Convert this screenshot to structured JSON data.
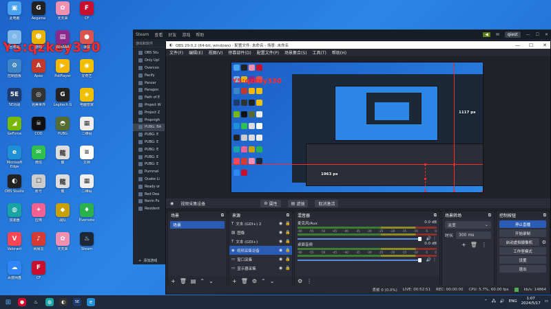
{
  "watermark": "YS:qzkey330",
  "desktop_icons": [
    {
      "label": "此电脑",
      "color": "#4aa3f0",
      "glyph": "▣"
    },
    {
      "label": "Aegame",
      "color": "#222222",
      "glyph": "G"
    },
    {
      "label": "天天来",
      "color": "#f08fb0",
      "glyph": "✿"
    },
    {
      "label": "CF",
      "color": "#c8102e",
      "glyph": "F"
    },
    {
      "label": "回收站",
      "color": "#7fb8e8",
      "glyph": "♲"
    },
    {
      "label": "游戏",
      "color": "#e8b400",
      "glyph": "☻"
    },
    {
      "label": "WinRAR",
      "color": "#8b2a8b",
      "glyph": "▤"
    },
    {
      "label": "录屏",
      "color": "#d9534f",
      "glyph": "●"
    },
    {
      "label": "控制面板",
      "color": "#3d85c6",
      "glyph": "⚙"
    },
    {
      "label": "Apex",
      "color": "#c0392b",
      "glyph": "A"
    },
    {
      "label": "PotPlayer",
      "color": "#f5b700",
      "glyph": "▶"
    },
    {
      "label": "爱奇艺",
      "color": "#f0c000",
      "glyph": "◉"
    },
    {
      "label": "5E对战",
      "color": "#1f3b6e",
      "glyph": "5E"
    },
    {
      "label": "完美世界",
      "color": "#333333",
      "glyph": "◎"
    },
    {
      "label": "Logitech G",
      "color": "#222222",
      "glyph": "G"
    },
    {
      "label": "电脑管家",
      "color": "#f0c000",
      "glyph": "◈"
    },
    {
      "label": "GeForce",
      "color": "#76b900",
      "glyph": "◢"
    },
    {
      "label": "COD",
      "color": "#111111",
      "glyph": "☠"
    },
    {
      "label": "PUBG",
      "color": "#556b2f",
      "glyph": "◓"
    },
    {
      "label": "二维码",
      "color": "#eeeeee",
      "glyph": "▦"
    },
    {
      "label": "Microsoft Edge",
      "color": "#1f8fd6",
      "glyph": "e"
    },
    {
      "label": "微信",
      "color": "#2fbf4f",
      "glyph": "✉"
    },
    {
      "label": "龍",
      "color": "#dddddd",
      "glyph": "龍"
    },
    {
      "label": "文档",
      "color": "#ffffff",
      "glyph": "≡"
    },
    {
      "label": "OBS Studio",
      "color": "#222222",
      "glyph": "◐"
    },
    {
      "label": "账号",
      "color": "#cccccc",
      "glyph": "☐"
    },
    {
      "label": "龍",
      "color": "#dddddd",
      "glyph": "龍"
    },
    {
      "label": "二维码",
      "color": "#eeeeee",
      "glyph": "▦"
    },
    {
      "label": "加速器",
      "color": "#1aa3a3",
      "glyph": "◍"
    },
    {
      "label": "应用",
      "color": "#f06292",
      "glyph": "✦"
    },
    {
      "label": "战队",
      "color": "#c8a000",
      "glyph": "◆"
    },
    {
      "label": "Evernote",
      "color": "#2bb24c",
      "glyph": "♦"
    },
    {
      "label": "Valorant",
      "color": "#ff4655",
      "glyph": "V"
    },
    {
      "label": "网易云",
      "color": "#d43c33",
      "glyph": "♪"
    },
    {
      "label": "天天来",
      "color": "#f08fb0",
      "glyph": "✿"
    },
    {
      "label": "Steam",
      "color": "#1b2838",
      "glyph": "♨"
    },
    {
      "label": "百度网盘",
      "color": "#2f86f6",
      "glyph": "☁"
    },
    {
      "label": "CF",
      "color": "#c8102e",
      "glyph": "F"
    }
  ],
  "steam": {
    "menu": [
      "Steam",
      "查看",
      "好友",
      "游戏",
      "帮助"
    ],
    "user": "qiest",
    "sidebar_header": "游戏和软件",
    "games": [
      "OBS Stu",
      "Only Up!",
      "Overcoo",
      "Pacify",
      "Panzar",
      "Paragon",
      "Path of E",
      "Project W",
      "Project Z",
      "Propnigh",
      "PUBG: BA",
      "PUBG: E",
      "PUBG: E",
      "PUBG: E",
      "PUBG: E",
      "PUBG: E",
      "Pummel",
      "Quake Li",
      "Ready or",
      "Red Dea",
      "Ronin Fo",
      "Resident"
    ],
    "add_game": "添加游戏"
  },
  "obs": {
    "title": "OBS 29.0.2 (64-bit, windows) - 配置文件: 未命名 - 场景: 未命名",
    "menu": [
      "文件(F)",
      "编辑(E)",
      "视图(V)",
      "停靠部件(D)",
      "配置文件(P)",
      "场景集合(S)",
      "工具(T)",
      "帮助(H)"
    ],
    "px_label_right": "1117 px",
    "px_label_bottom": "1963 px",
    "toolbar": {
      "source_name": "视频采集设备",
      "properties": "属性",
      "filters": "滤镜",
      "deactivate": "取消激活"
    },
    "scenes": {
      "title": "场景",
      "items": [
        "场景"
      ]
    },
    "sources": {
      "title": "来源",
      "items": [
        {
          "name": "文本 (GDI+) 2",
          "icon": "T"
        },
        {
          "name": "图像",
          "icon": "▨"
        },
        {
          "name": "文本 (GDI+)",
          "icon": "T"
        },
        {
          "name": "视频采集设备",
          "icon": "◉"
        },
        {
          "name": "窗口采集",
          "icon": "▭"
        },
        {
          "name": "显示器采集",
          "icon": "▭"
        }
      ]
    },
    "mixer": {
      "title": "混音器",
      "channels": [
        {
          "name": "麦克风/Aux",
          "db": "0.0 dB"
        },
        {
          "name": "桌面音频",
          "db": "0.0 dB"
        }
      ],
      "ticks": [
        "-60",
        "-55",
        "-50",
        "-45",
        "-40",
        "-35",
        "-30",
        "-25",
        "-20",
        "-15",
        "-10",
        "-5",
        "0"
      ]
    },
    "transitions": {
      "title": "场景转场",
      "type": "淡变",
      "duration_label": "时长",
      "duration": "300 ms"
    },
    "controls": {
      "title": "控制按钮",
      "buttons": [
        "停止直播",
        "开始录制",
        "启动虚拟摄像机",
        "工作室模式",
        "设置",
        "退出"
      ]
    },
    "status": {
      "dropped": "丢帧 0 (0.0%)",
      "live": "LIVE: 00:52:51",
      "rec": "REC: 00:00:00",
      "cpu": "CPU: 5.7%, 60.00 fps",
      "kbps": "kb/s: 14864"
    }
  },
  "taskbar": {
    "lang": "ENG",
    "time": "1:07",
    "date": "2024/5/17"
  }
}
